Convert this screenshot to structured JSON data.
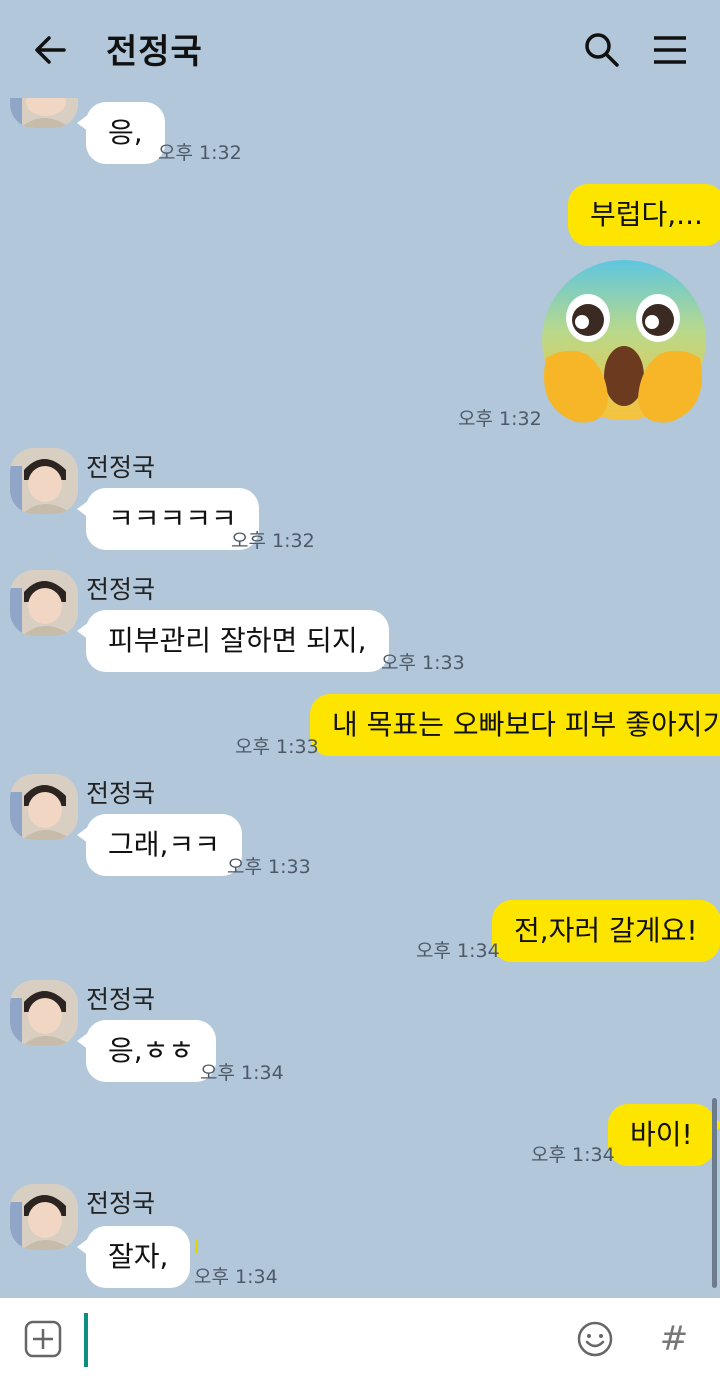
{
  "header": {
    "title": "전정국",
    "back_icon": "arrow-left-icon",
    "search_icon": "search-icon",
    "menu_icon": "hamburger-menu-icon"
  },
  "messages": [
    {
      "sender": "",
      "text": "응,",
      "time": "오후 1:32"
    },
    {
      "sender": "me",
      "text": "부럽다,...",
      "time": ""
    },
    {
      "sender": "me",
      "emoji": "fear-scream-emoji",
      "time": "오후 1:32"
    },
    {
      "sender": "전정국",
      "text": "ㅋㅋㅋㅋㅋ",
      "time": "오후 1:32"
    },
    {
      "sender": "전정국",
      "text": "피부관리 잘하면 되지,",
      "time": "오후 1:33"
    },
    {
      "sender": "me",
      "text": "내 목표는 오빠보다 피부 좋아지기,",
      "time": "오후 1:33"
    },
    {
      "sender": "전정국",
      "text": "그래,ㅋㅋ",
      "time": "오후 1:33"
    },
    {
      "sender": "me",
      "text": "전,자러 갈게요!",
      "time": "오후 1:34"
    },
    {
      "sender": "전정국",
      "text": "응,ㅎㅎ",
      "time": "오후 1:34"
    },
    {
      "sender": "me",
      "text": "바이!",
      "time": "오후 1:34"
    },
    {
      "sender": "전정국",
      "text": "잘자,",
      "time": "오후 1:34"
    }
  ],
  "input": {
    "placeholder": "",
    "plus_icon": "plus-square-icon",
    "emoji_icon": "smiley-icon",
    "hash_label": "#"
  },
  "colors": {
    "background": "#b2c7da",
    "my_bubble": "#fee500",
    "their_bubble": "#ffffff",
    "cursor": "#0d8f7f"
  }
}
